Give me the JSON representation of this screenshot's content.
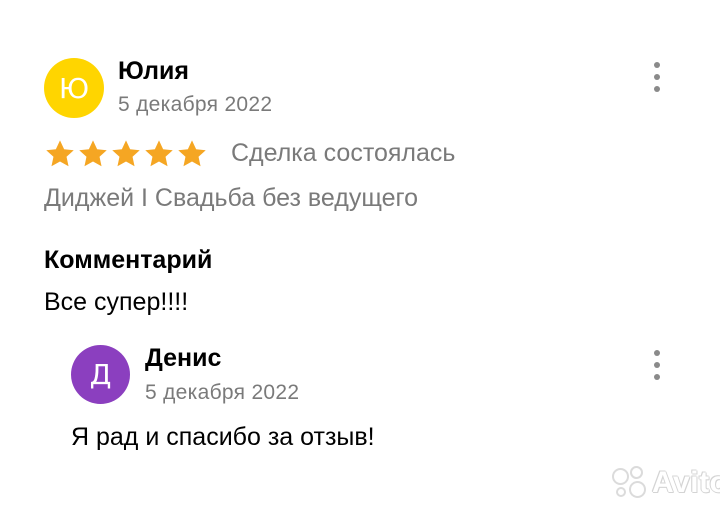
{
  "review": {
    "author": {
      "initial": "Ю",
      "name": "Юлия",
      "avatar_color": "#ffd500"
    },
    "date": "5 декабря 2022",
    "rating": 5,
    "rating_max": 5,
    "star_color": "#f5a623",
    "deal_status": "Сделка состоялась",
    "service": "Диджей I Свадьба без ведущего",
    "comment_heading": "Комментарий",
    "comment_text": "Все супер!!!!",
    "menu_icon": "more-vertical-icon"
  },
  "reply": {
    "author": {
      "initial": "Д",
      "name": "Денис",
      "avatar_color": "#8b3fbf"
    },
    "date": "5 декабря 2022",
    "text": "Я рад и спасибо за отзыв!",
    "menu_icon": "more-vertical-icon"
  },
  "watermark": {
    "text": "Avito"
  }
}
